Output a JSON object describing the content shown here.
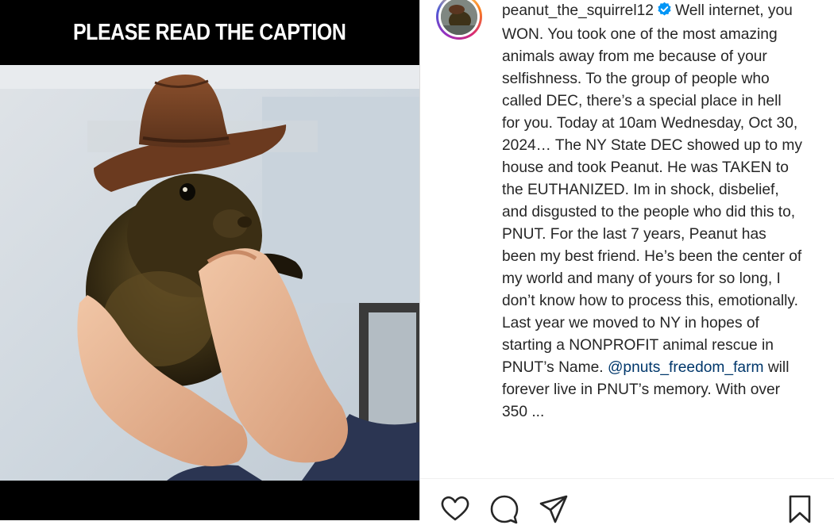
{
  "media": {
    "overlay_text": "PLEASE READ THE CAPTION"
  },
  "post": {
    "username": "peanut_the_squirrel12",
    "verified": true,
    "caption_main": "Well internet, you WON. You took one of the most amazing animals away from me because of your selfishness. To the group of people who called DEC, there’s a special place in hell for you. Today at 10am Wednesday, Oct 30, 2024… The NY State DEC showed up to my house and took Peanut. He was TAKEN to the EUTHANIZED. Im in shock, disbelief, and disgusted to the people who did this to, PNUT. For the last 7 years, Peanut has been my best friend. He’s been the center of my world and many of yours for so long, I don’t know how to process this, emotionally. Last year we moved to NY in hopes of starting a NONPROFIT animal rescue in PNUT’s Name.",
    "mention": "@pnuts_freedom_farm",
    "caption_after_mention": "will forever live in PNUT’s memory. With over 350 ..."
  },
  "colors": {
    "verified_badge": "#0095f6",
    "mention_link": "#00376b",
    "text": "#262626"
  },
  "icons": {
    "like": "heart-icon",
    "comment": "comment-icon",
    "share": "paper-plane-icon",
    "save": "bookmark-icon",
    "verified": "verified-badge-icon"
  }
}
